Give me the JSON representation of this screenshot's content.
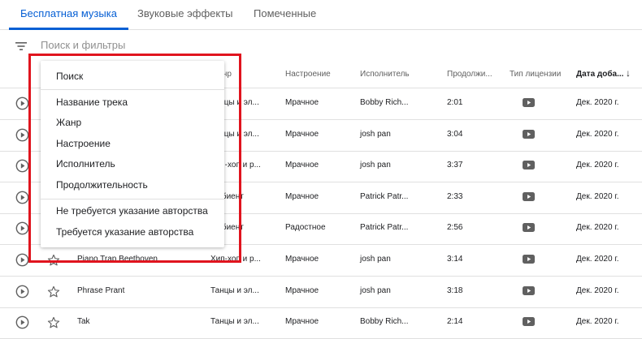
{
  "tabs": [
    {
      "label": "Бесплатная музыка",
      "active": true
    },
    {
      "label": "Звуковые эффекты",
      "active": false
    },
    {
      "label": "Помеченные",
      "active": false
    }
  ],
  "filter": {
    "placeholder": "Поиск и фильтры",
    "icon": "filter-icon"
  },
  "columns": {
    "genre": "Жанр",
    "mood": "Настроение",
    "artist": "Исполнитель",
    "duration": "Продолжи...",
    "license": "Тип лицензии",
    "date_added": "Дата доба...",
    "sort_icon": "arrow-down-icon"
  },
  "rows": [
    {
      "title": "",
      "genre": "Танцы и эл...",
      "mood": "Мрачное",
      "artist": "Bobby Rich...",
      "duration": "2:01",
      "date": "Дек. 2020 г."
    },
    {
      "title": "",
      "genre": "Танцы и эл...",
      "mood": "Мрачное",
      "artist": "josh pan",
      "duration": "3:04",
      "date": "Дек. 2020 г."
    },
    {
      "title": "",
      "genre": "Хип-хоп и р...",
      "mood": "Мрачное",
      "artist": "josh pan",
      "duration": "3:37",
      "date": "Дек. 2020 г."
    },
    {
      "title": "",
      "genre": "Эмбиент",
      "mood": "Мрачное",
      "artist": "Patrick Patr...",
      "duration": "2:33",
      "date": "Дек. 2020 г."
    },
    {
      "title": "",
      "genre": "Эмбиент",
      "mood": "Радостное",
      "artist": "Patrick Patr...",
      "duration": "2:56",
      "date": "Дек. 2020 г."
    },
    {
      "title": "Piano Trap Beethoven",
      "genre": "Хип-хоп и р...",
      "mood": "Мрачное",
      "artist": "josh pan",
      "duration": "3:14",
      "date": "Дек. 2020 г."
    },
    {
      "title": "Phrase Prant",
      "genre": "Танцы и эл...",
      "mood": "Мрачное",
      "artist": "josh pan",
      "duration": "3:18",
      "date": "Дек. 2020 г."
    },
    {
      "title": "Tak",
      "genre": "Танцы и эл...",
      "mood": "Мрачное",
      "artist": "Bobby Rich...",
      "duration": "2:14",
      "date": "Дек. 2020 г."
    }
  ],
  "menu": {
    "search": "Поиск",
    "items": [
      "Название трека",
      "Жанр",
      "Настроение",
      "Исполнитель",
      "Продолжительность"
    ],
    "attribution": [
      "Не требуется указание авторства",
      "Требуется указание авторства"
    ]
  },
  "colors": {
    "accent": "#065fd4",
    "highlight": "#e0141e"
  }
}
